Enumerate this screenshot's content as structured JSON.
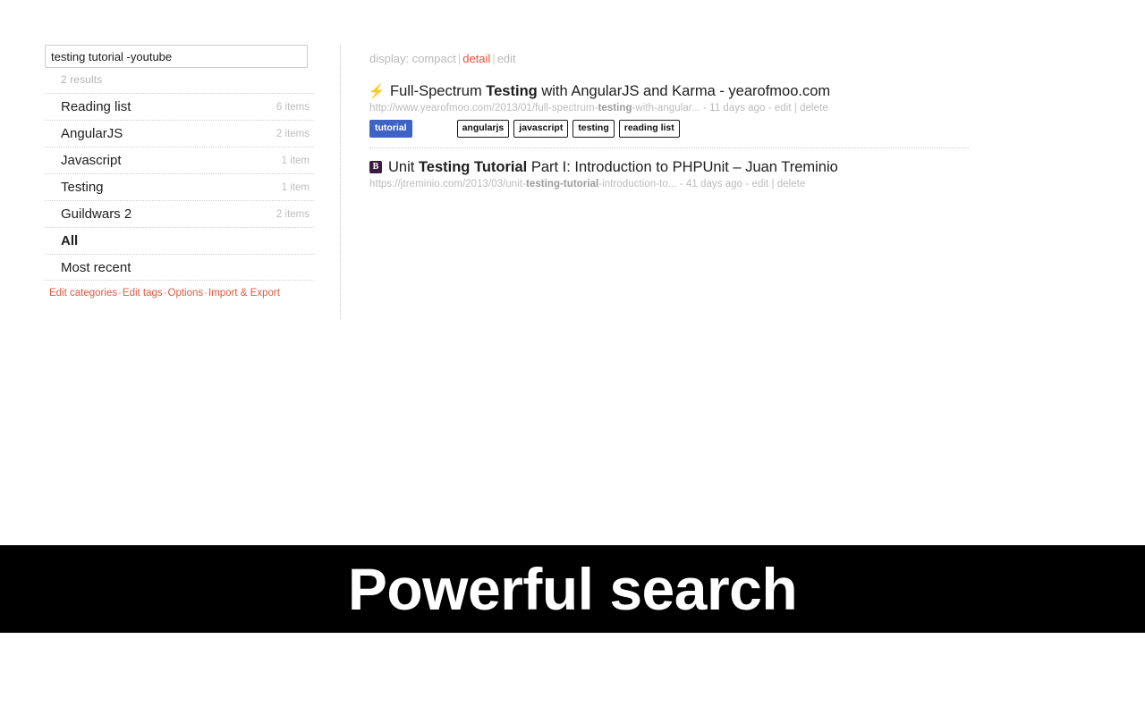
{
  "sidebar": {
    "search": {
      "value": "testing tutorial -youtube",
      "placeholder": "Search"
    },
    "results_count": "2 results",
    "categories": [
      {
        "label": "Reading list",
        "count": "6 items",
        "bold": false
      },
      {
        "label": "AngularJS",
        "count": "2 items",
        "bold": false
      },
      {
        "label": "Javascript",
        "count": "1 item",
        "bold": false
      },
      {
        "label": "Testing",
        "count": "1 item",
        "bold": false
      },
      {
        "label": "Guildwars 2",
        "count": "2 items",
        "bold": false
      },
      {
        "label": "All",
        "count": "",
        "bold": true
      },
      {
        "label": "Most recent",
        "count": "",
        "bold": false
      }
    ],
    "footer": {
      "edit_categories": "Edit categories",
      "edit_tags": "Edit tags",
      "options": "Options",
      "import_export": "Import & Export",
      "separator": "-"
    }
  },
  "display_bar": {
    "label": "display:",
    "compact": "compact",
    "detail": "detail",
    "edit": "edit",
    "pipe": "|",
    "active": "detail",
    "active_color": "#e8503a"
  },
  "results": [
    {
      "favicon": "lightning-bolt-icon",
      "favicon_glyph": "⚡",
      "title_before": "Full-Spectrum ",
      "title_highlight": "Testing",
      "title_after": " with AngularJS and Karma - yearofmoo.com",
      "url_before": "http://www.yearofmoo.com/2013/01/full-spectrum-",
      "url_highlight": "testing",
      "url_after": "-with-angular...",
      "age": "11 days ago",
      "edit_label": "edit",
      "delete_label": "delete",
      "tags_primary": [
        "tutorial"
      ],
      "tags_outline": [
        "angularjs",
        "javascript",
        "testing",
        "reading list"
      ],
      "primary_tag_color": "#3f63c4"
    },
    {
      "favicon": "blogger-b-icon",
      "favicon_glyph": "B",
      "title_before": "Unit ",
      "title_highlight": "Testing Tutorial",
      "title_after": " Part I: Introduction to PHPUnit – Juan Treminio",
      "url_before": "https://jtreminio.com/2013/03/unit-",
      "url_highlight": "testing-tutorial",
      "url_after": "-introduction-to...",
      "age": "41 days ago",
      "edit_label": "edit",
      "delete_label": "delete",
      "tags_primary": [],
      "tags_outline": [],
      "primary_tag_color": "#3f63c4"
    }
  ],
  "caption": {
    "text": "Powerful search",
    "background": "#000000",
    "color": "#ffffff"
  }
}
